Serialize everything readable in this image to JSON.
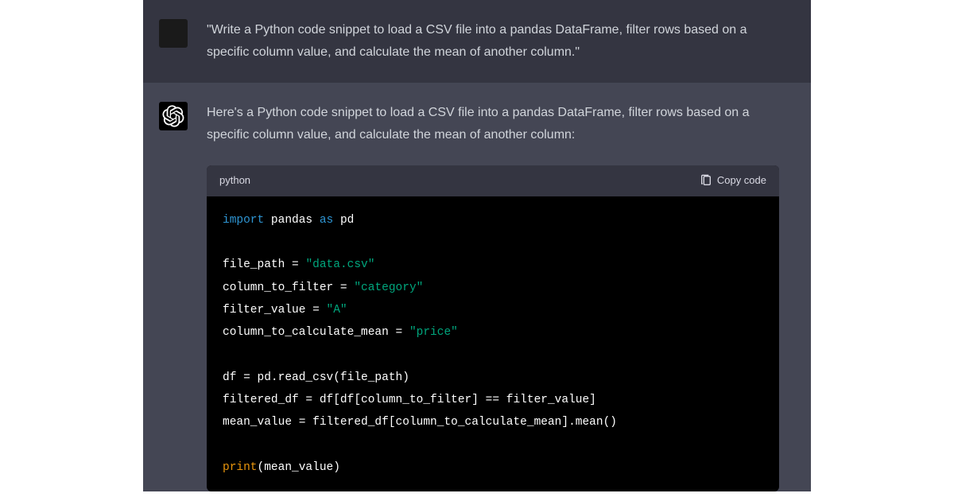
{
  "user": {
    "prompt": "\"Write a Python code snippet to load a CSV file into a pandas DataFrame, filter rows based on a specific column value, and calculate the mean of another column.\""
  },
  "assistant": {
    "intro": "Here's a Python code snippet to load a CSV file into a pandas DataFrame, filter rows based on a specific column value, and calculate the mean of another column:",
    "code": {
      "language": "python",
      "copy_label": "Copy code",
      "tokens": {
        "kw_import": "import",
        "id_pandas": "pandas",
        "kw_as": "as",
        "id_pd": "pd",
        "id_file_path": "file_path",
        "eq1": " = ",
        "str_data_csv": "\"data.csv\"",
        "id_column_to_filter": "column_to_filter",
        "eq2": " = ",
        "str_category": "\"category\"",
        "id_filter_value": "filter_value",
        "eq3": " = ",
        "str_A": "\"A\"",
        "id_column_to_calculate_mean": "column_to_calculate_mean",
        "eq4": " = ",
        "str_price": "\"price\"",
        "line_df": "df = pd.read_csv(file_path)",
        "line_filtered": "filtered_df = df[df[column_to_filter] == filter_value]",
        "line_mean": "mean_value = filtered_df[column_to_calculate_mean].mean()",
        "fn_print": "print",
        "print_rest": "(mean_value)"
      }
    }
  }
}
